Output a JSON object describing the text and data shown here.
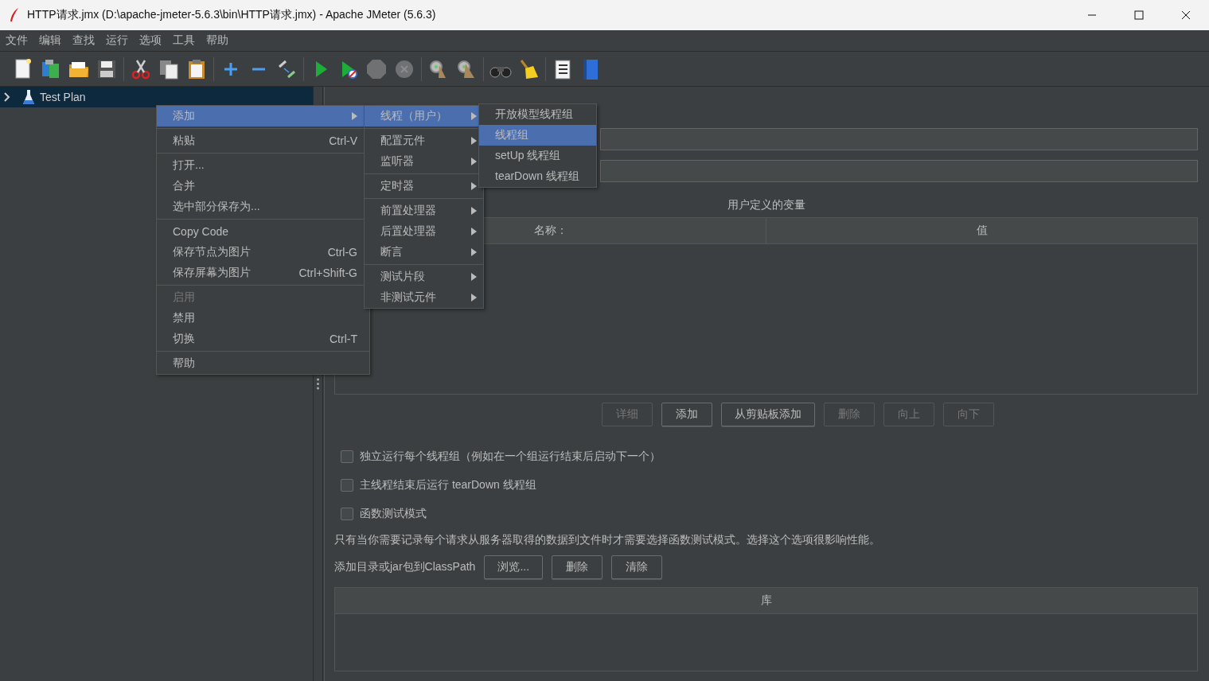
{
  "window": {
    "title": "HTTP请求.jmx (D:\\apache-jmeter-5.6.3\\bin\\HTTP请求.jmx) - Apache JMeter (5.6.3)"
  },
  "menubar": [
    "文件",
    "编辑",
    "查找",
    "运行",
    "选项",
    "工具",
    "帮助"
  ],
  "toolbar": [
    [
      {
        "kind": "new",
        "disabled": false
      },
      {
        "kind": "templates",
        "disabled": false
      },
      {
        "kind": "open",
        "disabled": false
      },
      {
        "kind": "save",
        "disabled": false
      }
    ],
    [
      {
        "kind": "cut",
        "disabled": false
      },
      {
        "kind": "copy",
        "disabled": false
      },
      {
        "kind": "paste",
        "disabled": false
      }
    ],
    [
      {
        "kind": "add",
        "disabled": false
      },
      {
        "kind": "remove",
        "disabled": false
      },
      {
        "kind": "toggle",
        "disabled": false
      }
    ],
    [
      {
        "kind": "start",
        "disabled": false
      },
      {
        "kind": "start-no-timers",
        "disabled": false
      },
      {
        "kind": "stop",
        "disabled": true
      },
      {
        "kind": "shutdown",
        "disabled": true
      }
    ],
    [
      {
        "kind": "clear",
        "disabled": false
      },
      {
        "kind": "clear-all",
        "disabled": false
      }
    ],
    [
      {
        "kind": "search",
        "disabled": false
      },
      {
        "kind": "reset-search",
        "disabled": false
      }
    ],
    [
      {
        "kind": "functions",
        "disabled": false
      },
      {
        "kind": "help",
        "disabled": false
      }
    ]
  ],
  "tree": [
    {
      "label": "Test Plan",
      "selected": true,
      "expanded": false
    }
  ],
  "context_menu": [
    [
      {
        "label": "添加",
        "submenu": true,
        "disabled": false,
        "selected": true
      }
    ],
    [
      {
        "label": "粘贴",
        "shortcut": "Ctrl-V",
        "submenu": false,
        "disabled": false,
        "selected": false
      }
    ],
    [
      {
        "label": "打开...",
        "submenu": false,
        "disabled": false,
        "selected": false
      },
      {
        "label": "合并",
        "submenu": false,
        "disabled": false,
        "selected": false
      },
      {
        "label": "选中部分保存为...",
        "submenu": false,
        "disabled": false,
        "selected": false
      }
    ],
    [
      {
        "label": "Copy Code",
        "submenu": false,
        "disabled": false,
        "selected": false
      },
      {
        "label": "保存节点为图片",
        "shortcut": "Ctrl-G",
        "submenu": false,
        "disabled": false,
        "selected": false
      },
      {
        "label": "保存屏幕为图片",
        "shortcut": "Ctrl+Shift-G",
        "submenu": false,
        "disabled": false,
        "selected": false
      }
    ],
    [
      {
        "label": "启用",
        "submenu": false,
        "disabled": true,
        "selected": false
      },
      {
        "label": "禁用",
        "submenu": false,
        "disabled": false,
        "selected": false
      },
      {
        "label": "切换",
        "shortcut": "Ctrl-T",
        "submenu": false,
        "disabled": false,
        "selected": false
      }
    ],
    [
      {
        "label": "帮助",
        "submenu": false,
        "disabled": false,
        "selected": false
      }
    ]
  ],
  "add_submenu": [
    [
      {
        "label": "线程（用户）",
        "selected": true
      }
    ],
    [
      {
        "label": "配置元件",
        "selected": false
      },
      {
        "label": "监听器",
        "selected": false
      }
    ],
    [
      {
        "label": "定时器",
        "selected": false
      }
    ],
    [
      {
        "label": "前置处理器",
        "selected": false
      },
      {
        "label": "后置处理器",
        "selected": false
      },
      {
        "label": "断言",
        "selected": false
      }
    ],
    [
      {
        "label": "测试片段",
        "selected": false
      },
      {
        "label": "非测试元件",
        "selected": false
      }
    ]
  ],
  "threads_submenu": [
    {
      "label": "开放模型线程组",
      "selected": false
    },
    {
      "label": "线程组",
      "selected": true
    },
    {
      "label": "setUp 线程组",
      "selected": false
    },
    {
      "label": "tearDown 线程组",
      "selected": false
    }
  ],
  "variables": {
    "title": "用户定义的变量",
    "columns": [
      "名称：",
      "值"
    ],
    "buttons": [
      {
        "label": "详细",
        "disabled": true
      },
      {
        "label": "添加",
        "disabled": false
      },
      {
        "label": "从剪贴板添加",
        "disabled": false
      },
      {
        "label": "删除",
        "disabled": true
      },
      {
        "label": "向上",
        "disabled": true
      },
      {
        "label": "向下",
        "disabled": true
      }
    ]
  },
  "options": [
    {
      "label": "独立运行每个线程组（例如在一个组运行结束后启动下一个）",
      "checked": false
    },
    {
      "label": "主线程结束后运行 tearDown 线程组",
      "checked": false
    },
    {
      "label": "函数测试模式",
      "checked": false
    }
  ],
  "note": "只有当你需要记录每个请求从服务器取得的数据到文件时才需要选择函数测试模式。选择这个选项很影响性能。",
  "classpath": {
    "label": "添加目录或jar包到ClassPath",
    "buttons": [
      "浏览...",
      "删除",
      "清除"
    ],
    "columns": [
      "库"
    ]
  }
}
